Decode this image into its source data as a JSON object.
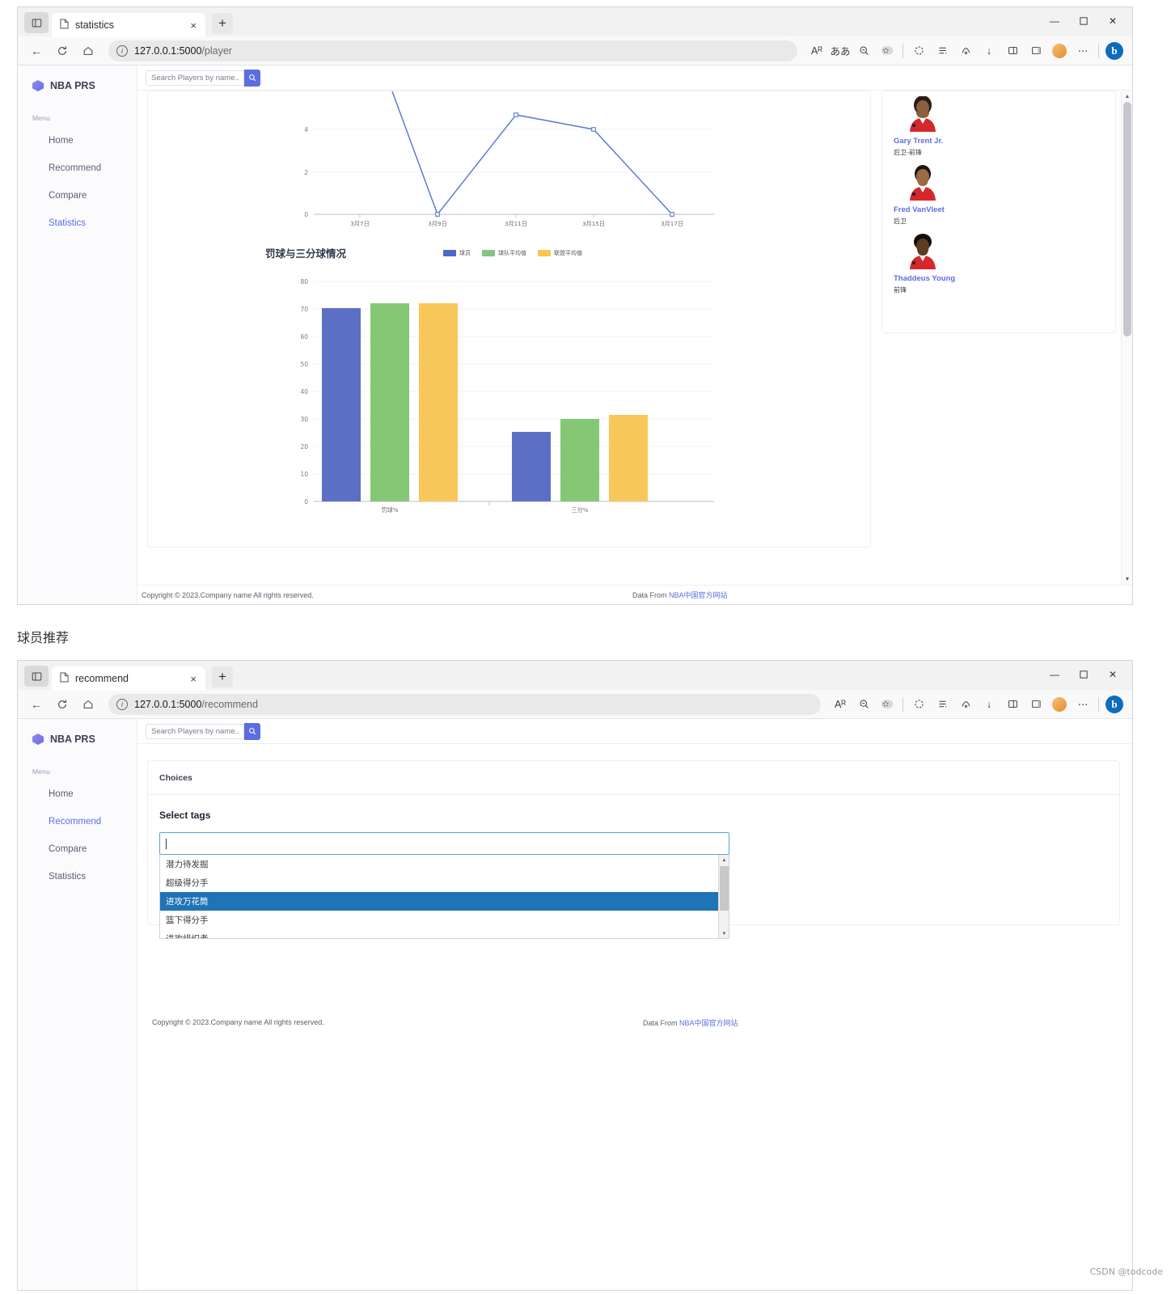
{
  "window1": {
    "tab": {
      "title": "statistics",
      "close_label": "×",
      "new_tab_label": "+"
    },
    "url": {
      "host": "127.0.0.1:5000",
      "path": "/player"
    },
    "controls": {
      "minimize": "—",
      "maximize": "❐",
      "close": "✕"
    },
    "nav": {
      "back": "←",
      "reload": "↻",
      "home": "⌂",
      "read_aloud": "Aᴿ",
      "translate": "ああ",
      "zoom_out": "⊖",
      "favorite": "☆",
      "copilot": "◌",
      "collections": "≣",
      "browser_essentials": "⊕",
      "downloads": "↓",
      "split_screen": "❑",
      "edge_logo": "e",
      "settings_more": "⋯",
      "bing": "b"
    }
  },
  "window2": {
    "tab": {
      "title": "recommend",
      "close_label": "×",
      "new_tab_label": "+"
    },
    "url": {
      "host": "127.0.0.1:5000",
      "path": "/recommend"
    },
    "controls": {
      "minimize": "—",
      "maximize": "❐",
      "close": "✕"
    }
  },
  "app": {
    "brand": "NBA PRS",
    "menu_label": "Menu",
    "nav_items": [
      {
        "label": "Home",
        "active": false
      },
      {
        "label": "Recommend",
        "active": false
      },
      {
        "label": "Compare",
        "active": false
      },
      {
        "label": "Statistics",
        "active": true
      }
    ],
    "nav_items_2": [
      {
        "label": "Home",
        "active": false
      },
      {
        "label": "Recommend",
        "active": true
      },
      {
        "label": "Compare",
        "active": false
      },
      {
        "label": "Statistics",
        "active": false
      }
    ],
    "search": {
      "placeholder": "Search Players by name..",
      "button_icon": "🔍"
    },
    "footer": {
      "copyright": "Copyright © 2023.Company name All rights reserved.",
      "data_from_prefix": "Data From ",
      "data_from_link": "NBA中国官方网站"
    }
  },
  "statistics": {
    "players": [
      {
        "name": "Gary Trent Jr.",
        "position": "后卫-前锋"
      },
      {
        "name": "Fred VanVleet",
        "position": "后卫"
      },
      {
        "name": "Thaddeus Young",
        "position": "前锋"
      }
    ],
    "scrollbar": {
      "up": "▲",
      "down": "▼"
    }
  },
  "recommend": {
    "choices_header": "Choices",
    "select_label": "Select tags",
    "input_value": "",
    "options": [
      "潜力待发掘",
      "超级得分手",
      "进攻万花筒",
      "篮下得分手",
      "进攻组织者"
    ],
    "selected_option": "进攻万花筒",
    "scrollbar": {
      "up": "▲",
      "down": "▼"
    }
  },
  "caption": "球员推荐",
  "watermark": "CSDN @todcode",
  "chart_data": [
    {
      "type": "line",
      "title": "",
      "x": [
        "3月7日",
        "3月9日",
        "3月11日",
        "3月15日",
        "3月17日"
      ],
      "series": [
        {
          "name": "",
          "values": [
            9,
            0,
            5,
            4,
            0
          ],
          "color": "#5b7bd5"
        }
      ],
      "yticks": [
        0,
        2,
        4
      ],
      "ylim": [
        0,
        6
      ],
      "grid": true,
      "xlabel": "",
      "ylabel": ""
    },
    {
      "type": "bar",
      "title": "罚球与三分球情况",
      "categories": [
        "罚球%",
        "三分%"
      ],
      "series": [
        {
          "name": "球员",
          "values": [
            70.3,
            25.2
          ],
          "color": "#5b6fc4"
        },
        {
          "name": "球队平均值",
          "values": [
            72.0,
            29.8
          ],
          "color": "#84c775"
        },
        {
          "name": "联盟平均值",
          "values": [
            72.0,
            31.3
          ],
          "color": "#f8c košek"
        }
      ],
      "legend": [
        "球员",
        "球队平均值",
        "联盟平均值"
      ],
      "legend_colors": [
        "#4e68c8",
        "#81c784",
        "#f9c council"
      ],
      "yticks": [
        0,
        10,
        20,
        30,
        40,
        50,
        60,
        70,
        80
      ],
      "ylim": [
        0,
        80
      ],
      "grid": true,
      "xlabel": "",
      "ylabel": ""
    }
  ]
}
